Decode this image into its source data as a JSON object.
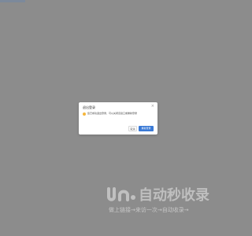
{
  "page": {
    "background_color": "#8c8c8c"
  },
  "dialog": {
    "title": "退出登录",
    "message": "您已成功退出登录，可以关闭该窗口或重新登录",
    "icon": "warning-circle-icon",
    "buttons": {
      "cancel": "取消",
      "primary": "重新登录"
    },
    "accent_color": "#3a7ad6"
  },
  "watermark": {
    "brand": "自动秒收录",
    "tagline": "做上链接→来访一次→自动收录→"
  }
}
